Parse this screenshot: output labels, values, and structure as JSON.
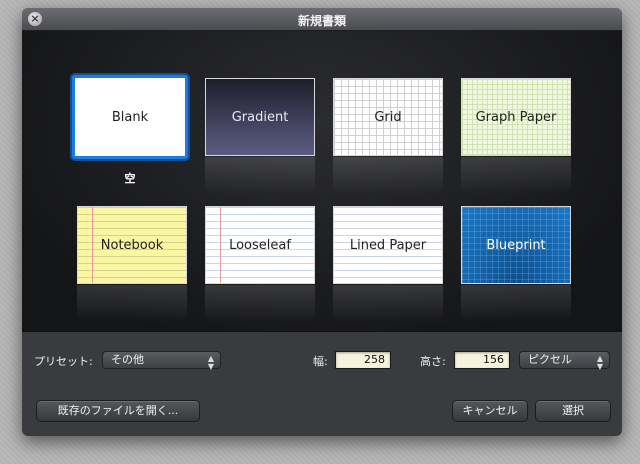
{
  "window": {
    "title": "新規書類"
  },
  "templates": [
    {
      "label": "Blank",
      "caption": "空",
      "selected": true
    },
    {
      "label": "Gradient"
    },
    {
      "label": "Grid"
    },
    {
      "label": "Graph Paper"
    },
    {
      "label": "Notebook"
    },
    {
      "label": "Looseleaf"
    },
    {
      "label": "Lined Paper"
    },
    {
      "label": "Blueprint"
    }
  ],
  "options": {
    "preset_label": "プリセット:",
    "preset_value": "その他",
    "width_label": "幅:",
    "width_value": "258",
    "height_label": "高さ:",
    "height_value": "156",
    "unit_value": "ピクセル"
  },
  "buttons": {
    "open_existing": "既存のファイルを開く...",
    "cancel": "キャンセル",
    "choose": "選択"
  },
  "colors": {
    "selection_accent": "#1d7ce0",
    "blueprint": "#1367b3"
  }
}
